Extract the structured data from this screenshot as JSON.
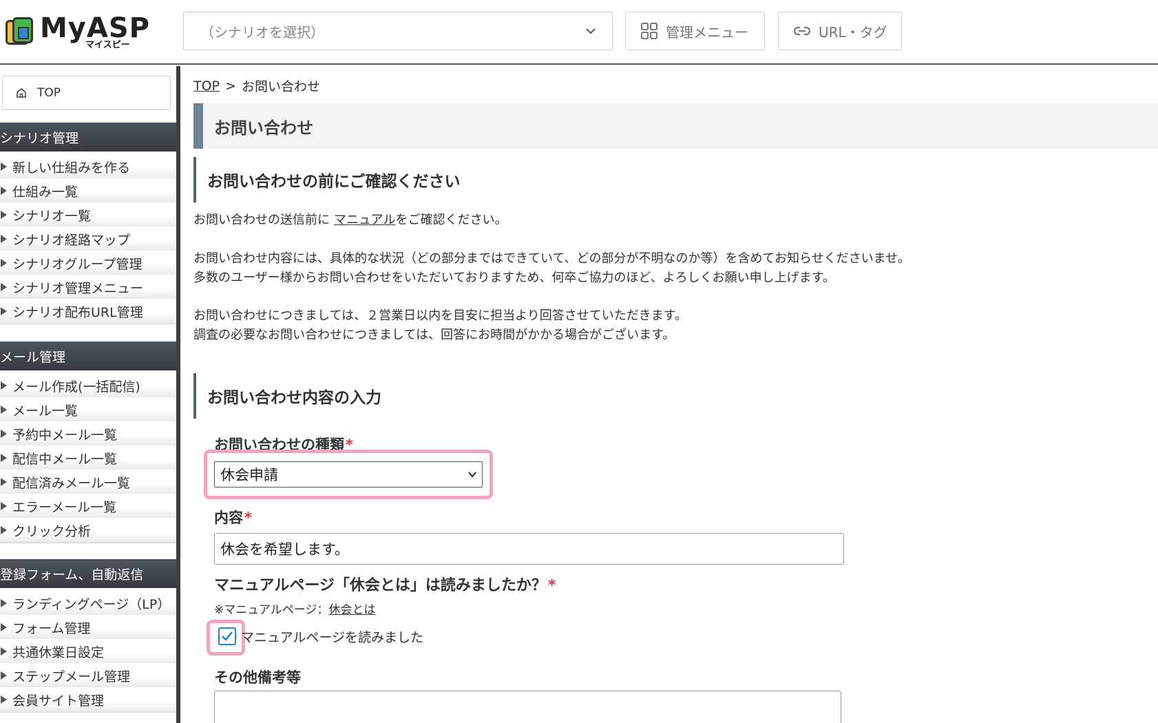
{
  "header": {
    "logo_text": "MyASP",
    "logo_sub": "マイスピー",
    "scenario_placeholder": "（シナリオを選択）",
    "admin_menu_label": "管理メニュー",
    "url_tag_label": "URL・タグ"
  },
  "sidebar": {
    "top_label": "TOP",
    "sections": [
      {
        "title": "シナリオ管理",
        "items": [
          "新しい仕組みを作る",
          "仕組み一覧",
          "シナリオ一覧",
          "シナリオ経路マップ",
          "シナリオグループ管理",
          "シナリオ管理メニュー",
          "シナリオ配布URL管理"
        ]
      },
      {
        "title": "メール管理",
        "items": [
          "メール作成(一括配信)",
          "メール一覧",
          "予約中メール一覧",
          "配信中メール一覧",
          "配信済みメール一覧",
          "エラーメール一覧",
          "クリック分析"
        ]
      },
      {
        "title": "登録フォーム、自動返信",
        "items": [
          "ランディングページ（LP）",
          "フォーム管理",
          "共通休業日設定",
          "ステップメール管理",
          "会員サイト管理"
        ]
      }
    ]
  },
  "breadcrumb": {
    "home": "TOP",
    "separator": ">",
    "current": "お問い合わせ"
  },
  "page_title": "お問い合わせ",
  "notice": {
    "heading": "お問い合わせの前にご確認ください",
    "line1_prefix": "お問い合わせの送信前に",
    "line1_link": "マニュアル",
    "line1_suffix": "をご確認ください。",
    "line2": "お問い合わせ内容には、具体的な状況（どの部分まではできていて、どの部分が不明なのか等）を含めてお知らせくださいませ。",
    "line3": "多数のユーザー様からお問い合わせをいただいておりますため、何卒ご協力のほど、よろしくお願い申し上げます。",
    "line4": "お問い合わせにつきましては、２営業日以内を目安に担当より回答させていただきます。",
    "line5": "調査の必要なお問い合わせにつきましては、回答にお時間がかかる場合がございます。"
  },
  "form": {
    "heading": "お問い合わせ内容の入力",
    "type_label": "お問い合わせの種類",
    "required_mark": "*",
    "type_value": "休会申請",
    "content_label": "内容",
    "content_value": "休会を希望します。",
    "manual_question": "マニュアルページ「休会とは」は読みましたか？",
    "manual_note_prefix": "※マニュアルページ：",
    "manual_note_link": "休会とは",
    "checkbox_label": "マニュアルページを読みました",
    "checkbox_checked": true,
    "remarks_label": "その他備考等",
    "remarks_value": ""
  },
  "colors": {
    "sidebar_section_bg": "#3f464c",
    "highlight_pink": "#f5a3c4",
    "required_red": "#e0353a",
    "checkbox_blue": "#1e86c8"
  }
}
